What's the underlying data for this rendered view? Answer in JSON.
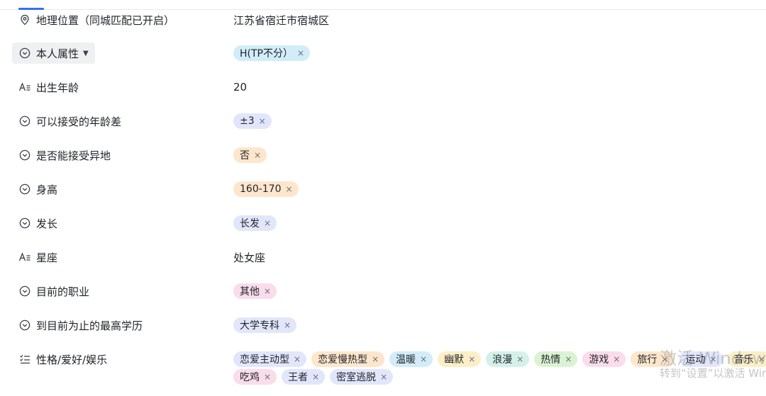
{
  "fields": {
    "location": {
      "label": "地理位置（同城匹配已开启）",
      "value": "江苏省宿迁市宿城区",
      "icon": "location-pin-icon"
    },
    "self_attr": {
      "label": "本人属性",
      "tags": [
        {
          "text": "H(TP不分）",
          "color": "#d2ecf9"
        }
      ],
      "icon": "circle-chevron-icon"
    },
    "birth_age": {
      "label": "出生年龄",
      "value": "20",
      "icon": "text-field-icon"
    },
    "age_gap": {
      "label": "可以接受的年龄差",
      "tags": [
        {
          "text": "±3",
          "color": "#e1e6fb"
        }
      ],
      "icon": "circle-chevron-icon"
    },
    "long_distance": {
      "label": "是否能接受异地",
      "tags": [
        {
          "text": "否",
          "color": "#fde6cc"
        }
      ],
      "icon": "circle-chevron-icon"
    },
    "height": {
      "label": "身高",
      "tags": [
        {
          "text": "160-170",
          "color": "#fde6cc"
        }
      ],
      "icon": "circle-chevron-icon"
    },
    "hair": {
      "label": "发长",
      "tags": [
        {
          "text": "长发",
          "color": "#e1e6fb"
        }
      ],
      "icon": "circle-chevron-icon"
    },
    "zodiac": {
      "label": "星座",
      "value": "处女座",
      "icon": "text-field-icon"
    },
    "job": {
      "label": "目前的职业",
      "tags": [
        {
          "text": "其他",
          "color": "#fadcea"
        }
      ],
      "icon": "circle-chevron-icon"
    },
    "education": {
      "label": "到目前为止的最高学历",
      "tags": [
        {
          "text": "大学专科",
          "color": "#e1e6fb"
        }
      ],
      "icon": "circle-chevron-icon"
    },
    "hobbies": {
      "label": "性格/爱好/娱乐",
      "icon": "multi-select-icon",
      "tags": [
        {
          "text": "恋爱主动型",
          "color": "#e1e6fb"
        },
        {
          "text": "恋爱慢热型",
          "color": "#fde6cc"
        },
        {
          "text": "温暖",
          "color": "#d2ecf9"
        },
        {
          "text": "幽默",
          "color": "#fcefc7"
        },
        {
          "text": "浪漫",
          "color": "#d3f1e8"
        },
        {
          "text": "热情",
          "color": "#dcf3d3"
        },
        {
          "text": "游戏",
          "color": "#fadcea"
        },
        {
          "text": "旅行",
          "color": "#fde6cc"
        },
        {
          "text": "运动",
          "color": "#e1e6fb"
        },
        {
          "text": "音乐",
          "color": "#fcefc7"
        },
        {
          "text": "吃鸡",
          "color": "#fadcea"
        },
        {
          "text": "王者",
          "color": "#e1e6fb"
        },
        {
          "text": "密室逃脱",
          "color": "#e1e6fb"
        }
      ]
    }
  },
  "remove_symbol": "×",
  "dropdown_caret": "▼",
  "watermark": {
    "line1": "激活 Windows",
    "line2": "转到“设置”以激活 Windows。"
  }
}
